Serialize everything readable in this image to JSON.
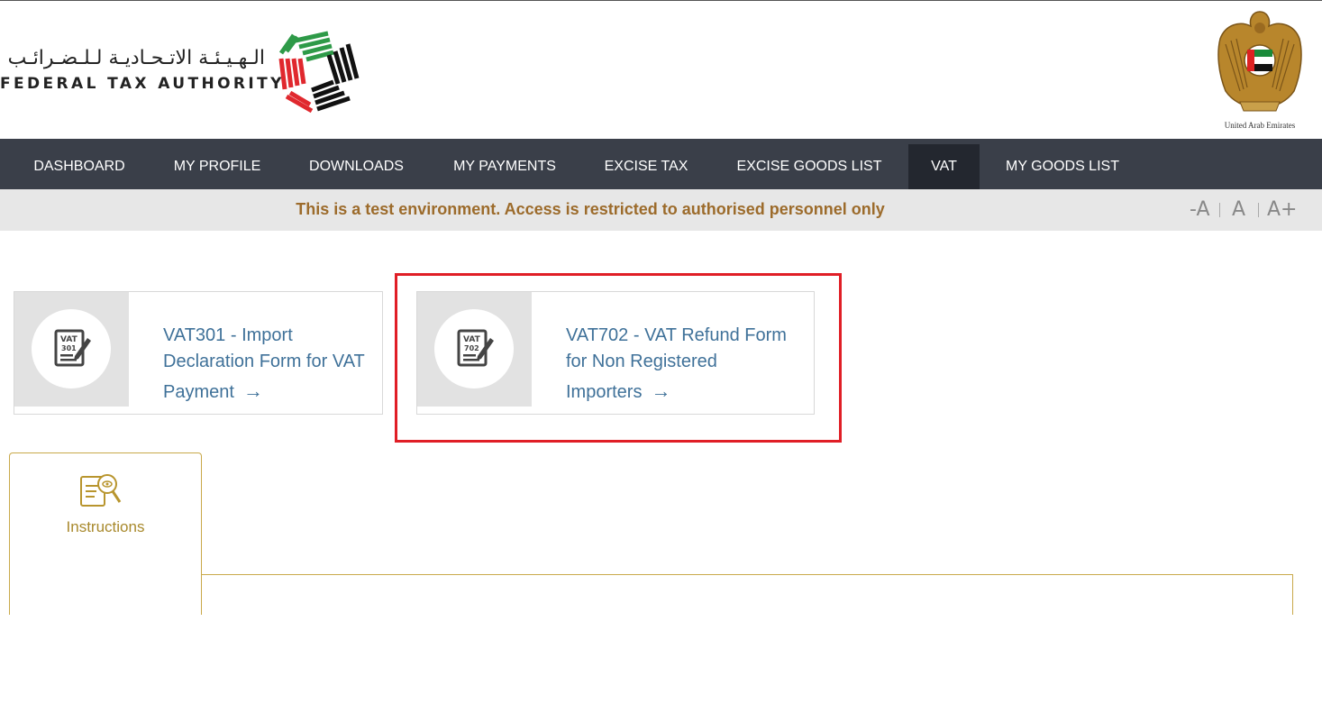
{
  "header": {
    "logo_arabic": "الـهـيـئـة الاتـحـاديـة لـلـضـرائـب",
    "logo_english": "FEDERAL TAX AUTHORITY",
    "emblem_caption": "United Arab Emirates"
  },
  "nav": {
    "items": [
      {
        "label": "DASHBOARD"
      },
      {
        "label": "MY PROFILE"
      },
      {
        "label": "DOWNLOADS"
      },
      {
        "label": "MY PAYMENTS"
      },
      {
        "label": "EXCISE TAX"
      },
      {
        "label": "EXCISE GOODS LIST"
      },
      {
        "label": "VAT"
      },
      {
        "label": "MY GOODS LIST"
      }
    ],
    "active": "VAT"
  },
  "notice": {
    "text": "This is a test environment. Access is restricted to authorised personnel only"
  },
  "font_controls": {
    "decrease": "-A",
    "normal": "A",
    "increase": "A+"
  },
  "cards": [
    {
      "icon": "vat-form-icon",
      "icon_code": "301",
      "title_line1": "VAT301 - Import",
      "title_line2": "Declaration Form for VAT",
      "title_line3": "Payment",
      "arrow": "→"
    },
    {
      "icon": "vat-form-icon",
      "icon_code": "702",
      "title_line1": "VAT702 - VAT Refund Form",
      "title_line2": "for Non Registered",
      "title_line3": "Importers",
      "arrow": "→"
    }
  ],
  "tabs": [
    {
      "label": "Instructions",
      "icon": "instructions-icon"
    }
  ],
  "colors": {
    "nav_bg": "#3a3f49",
    "nav_active": "#23272f",
    "notice_text": "#9c6b2b",
    "link": "#3f7199",
    "highlight": "#e01e26",
    "tab_accent": "#c9a94a"
  }
}
